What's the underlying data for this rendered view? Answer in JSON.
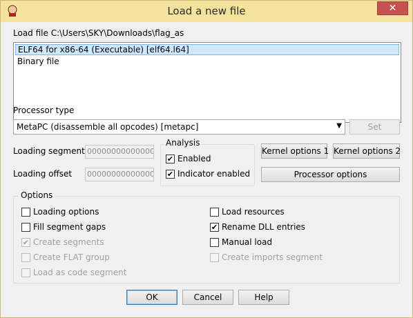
{
  "window": {
    "title": "Load a new file",
    "close_glyph": "✕",
    "app_icon": "ida-icon"
  },
  "load_file_label": "Load file C:\\Users\\SKY\\Downloads\\flag_as",
  "file_types": [
    {
      "label": "ELF64 for x86-64 (Executable) [elf64.l64]",
      "selected": true
    },
    {
      "label": "Binary file",
      "selected": false
    }
  ],
  "processor": {
    "label": "Processor type",
    "value": "MetaPC (disassemble all opcodes) [metapc]",
    "set_label": "Set",
    "dropdown_glyph": "▼"
  },
  "loading_segment": {
    "label": "Loading segment",
    "value": "0000000000000000"
  },
  "loading_offset": {
    "label": "Loading offset",
    "value": "0000000000000000"
  },
  "analysis": {
    "title": "Analysis",
    "enabled": {
      "label": "Enabled",
      "checked": true
    },
    "indicator": {
      "label": "Indicator enabled",
      "checked": true
    }
  },
  "kernel_options_1": "Kernel options 1",
  "kernel_options_2": "Kernel options 2",
  "processor_options": "Processor options",
  "options": {
    "title": "Options",
    "left": [
      {
        "label": "Loading options",
        "checked": false,
        "enabled": true
      },
      {
        "label": "Fill segment gaps",
        "checked": false,
        "enabled": true
      },
      {
        "label": "Create segments",
        "checked": true,
        "enabled": false
      },
      {
        "label": "Create FLAT group",
        "checked": false,
        "enabled": false
      },
      {
        "label": "Load as code segment",
        "checked": false,
        "enabled": false
      }
    ],
    "right": [
      {
        "label": "Load resources",
        "checked": false,
        "enabled": true
      },
      {
        "label": "Rename DLL entries",
        "checked": true,
        "enabled": true
      },
      {
        "label": "Manual load",
        "checked": false,
        "enabled": true
      },
      {
        "label": "Create imports segment",
        "checked": false,
        "enabled": false
      }
    ]
  },
  "buttons": {
    "ok": "OK",
    "cancel": "Cancel",
    "help": "Help"
  },
  "check_glyph": "✔"
}
